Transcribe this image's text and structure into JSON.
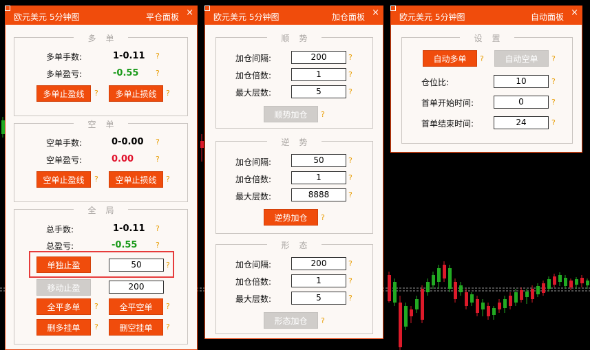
{
  "colors": {
    "accent": "#f04c0c",
    "disabled": "#d0cdca",
    "profit_green": "#1a9a1a",
    "loss_red": "#e0102a",
    "help": "#e89c00",
    "highlight": "#e63b3b"
  },
  "help_mark": "?",
  "close_glyph": "×",
  "panel_close": {
    "symbol": "欧元美元 5分钟图",
    "title": "平仓面板",
    "long": {
      "group_title": "多单",
      "lots_label": "多单手数:",
      "lots_value": "1-0.11",
      "pnl_label": "多单盈亏:",
      "pnl_value": "-0.55",
      "tp_button": "多单止盈线",
      "sl_button": "多单止损线"
    },
    "short": {
      "group_title": "空单",
      "lots_label": "空单手数:",
      "lots_value": "0-0.00",
      "pnl_label": "空单盈亏:",
      "pnl_value": "0.00",
      "tp_button": "空单止盈线",
      "sl_button": "空单止损线"
    },
    "global": {
      "group_title": "全局",
      "lots_label": "总手数:",
      "lots_value": "1-0.11",
      "pnl_label": "总盈亏:",
      "pnl_value": "-0.55",
      "single_tp_button": "单独止盈",
      "single_tp_value": "50",
      "move_tp_button": "移动止盈",
      "move_tp_value": "200",
      "close_all_long": "全平多单",
      "close_all_short": "全平空单",
      "delete_long_pending": "删多挂单",
      "delete_short_pending": "删空挂单"
    }
  },
  "panel_add": {
    "symbol": "欧元美元 5分钟图",
    "title": "加仓面板",
    "trend": {
      "group_title": "顺势",
      "interval_label": "加仓间隔:",
      "interval_value": "200",
      "multiplier_label": "加仓倍数:",
      "multiplier_value": "1",
      "max_layers_label": "最大层数:",
      "max_layers_value": "5",
      "button": "顺势加仓"
    },
    "counter": {
      "group_title": "逆势",
      "interval_label": "加仓间隔:",
      "interval_value": "50",
      "multiplier_label": "加仓倍数:",
      "multiplier_value": "1",
      "max_layers_label": "最大层数:",
      "max_layers_value": "8888",
      "button": "逆势加仓"
    },
    "pattern": {
      "group_title": "形态",
      "interval_label": "加仓间隔:",
      "interval_value": "200",
      "multiplier_label": "加仓倍数:",
      "multiplier_value": "1",
      "max_layers_label": "最大层数:",
      "max_layers_value": "5",
      "button": "形态加仓"
    }
  },
  "panel_auto": {
    "symbol": "欧元美元 5分钟图",
    "title": "自动面板",
    "settings": {
      "group_title": "设置",
      "auto_long_button": "自动多单",
      "auto_short_button": "自动空单",
      "ratio_label": "仓位比:",
      "ratio_value": "10",
      "start_label": "首单开始时间:",
      "start_value": "0",
      "end_label": "首单结束时间:",
      "end_value": "24"
    }
  }
}
